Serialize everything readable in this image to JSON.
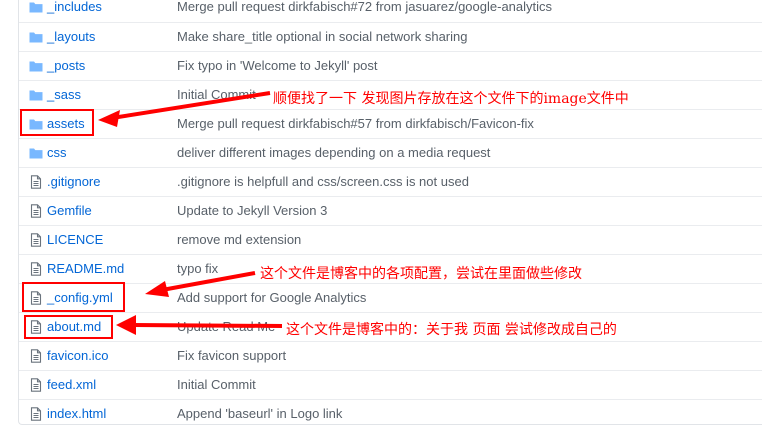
{
  "files": [
    {
      "type": "folder",
      "name": "_includes",
      "message": "Merge pull request ",
      "link": "dirkfabisch#72",
      "rest": " from jasuarez/google-analytics"
    },
    {
      "type": "folder",
      "name": "_layouts",
      "message": "Make share_title optional in social network sharing",
      "link": "",
      "rest": ""
    },
    {
      "type": "folder",
      "name": "_posts",
      "message": "Fix typo in 'Welcome to Jekyll' post",
      "link": "",
      "rest": ""
    },
    {
      "type": "folder",
      "name": "_sass",
      "message": "Initial Commit",
      "link": "",
      "rest": ""
    },
    {
      "type": "folder",
      "name": "assets",
      "message": "Merge pull request ",
      "link": "dirkfabisch#57",
      "rest": " from dirkfabisch/Favicon-fix"
    },
    {
      "type": "folder",
      "name": "css",
      "message": "deliver different images depending on a media request",
      "link": "",
      "rest": ""
    },
    {
      "type": "file",
      "name": ".gitignore",
      "message": ".gitignore is helpfull and css/screen.css is not used",
      "link": "",
      "rest": ""
    },
    {
      "type": "file",
      "name": "Gemfile",
      "message": "Update to Jekyll Version 3",
      "link": "",
      "rest": ""
    },
    {
      "type": "file",
      "name": "LICENCE",
      "message": "remove md extension",
      "link": "",
      "rest": ""
    },
    {
      "type": "file",
      "name": "README.md",
      "message": "typo fix",
      "link": "",
      "rest": ""
    },
    {
      "type": "file",
      "name": "_config.yml",
      "message": "Add support for Google Analytics",
      "link": "",
      "rest": ""
    },
    {
      "type": "file",
      "name": "about.md",
      "message": "Update Read Me",
      "link": "",
      "rest": ""
    },
    {
      "type": "file",
      "name": "favicon.ico",
      "message": "Fix favicon support",
      "link": "",
      "rest": ""
    },
    {
      "type": "file",
      "name": "feed.xml",
      "message": "Initial Commit",
      "link": "",
      "rest": ""
    },
    {
      "type": "file",
      "name": "index.html",
      "message": "Append 'baseurl' in Logo link",
      "link": "",
      "rest": ""
    }
  ],
  "annotations": {
    "assets_note": "顺便找了一下 发现图片存放在这个文件下的image文件中",
    "config_note": "这个文件是博客中的各项配置，尝试在里面做些修改",
    "about_note": "这个文件是博客中的：关于我 页面 尝试修改成自己的"
  },
  "colors": {
    "link": "#0366d6",
    "folder_icon": "#79b8ff",
    "file_icon": "#6a737d",
    "annotation": "#ff0000"
  },
  "icons": {
    "folder": "folder-icon",
    "file": "file-icon"
  }
}
